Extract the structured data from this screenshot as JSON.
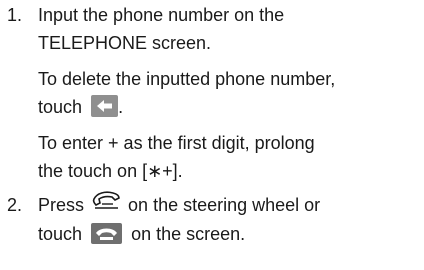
{
  "steps": [
    {
      "number": "1.",
      "line1": "Input the phone number on the",
      "line2": "TELEPHONE screen.",
      "delete_line1": "To delete the inputted phone number,",
      "delete_line2_prefix": "touch",
      "delete_line2_suffix": ".",
      "plus_line1": "To enter + as the first digit, prolong",
      "plus_line2": "the touch on [∗+]."
    },
    {
      "number": "2.",
      "line1_prefix": "Press",
      "line1_suffix": "on the steering wheel or",
      "line2_prefix": "touch",
      "line2_suffix": "on the screen."
    }
  ],
  "icons": {
    "back": "back-arrow-icon",
    "steering_phone": "steering-wheel-phone-icon",
    "call": "call-handset-icon"
  },
  "colors": {
    "text": "#1a1a1a",
    "back_button": "#8f8f8f",
    "call_button": "#6f6f6f"
  }
}
